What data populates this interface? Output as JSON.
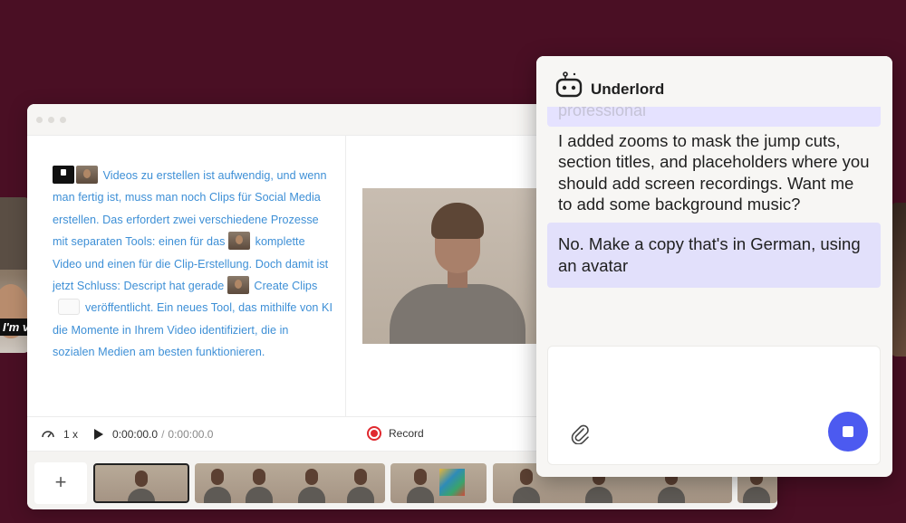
{
  "side_video": {
    "caption": "I'm v"
  },
  "script": {
    "text": "Videos zu erstellen ist aufwendig, und wenn man fertig ist, muss man noch Clips für Social Media erstellen. Das erfordert zwei verschiedene Prozesse mit separaten Tools: einen für das",
    "text2": "komplette Video und einen für die Clip-Erstellung. Doch damit ist jetzt Schluss: Descript hat gerade",
    "text3": "Create Clips",
    "text4": "veröffentlicht. Ein neues Tool, das mithilfe von KI die Momente in Ihrem Video identifiziert, die in sozialen Medien am besten funktionieren."
  },
  "transport": {
    "speed": "1 x",
    "current_time": "0:00:00.0",
    "separator": "/",
    "total_time": "0:00:00.0",
    "record_label": "Record"
  },
  "timeline": {
    "add_label": "+"
  },
  "panel": {
    "title": "Underlord",
    "faded_message": "professional",
    "ai_message": "I added zooms to mask the jump cuts, section titles, and placeholders where you should add screen recordings. Want me to add some background music?",
    "user_message": "No. Make a copy that's in German, using an avatar"
  },
  "colors": {
    "background": "#4a0f24",
    "script_text": "#3d8fd6",
    "accent": "#4c5af0",
    "user_bubble": "#e2e0fb",
    "record": "#e0282e"
  },
  "icons": [
    "robot-icon",
    "paperclip-icon",
    "stop-icon",
    "play-icon",
    "speed-icon",
    "record-icon",
    "plus-icon"
  ]
}
